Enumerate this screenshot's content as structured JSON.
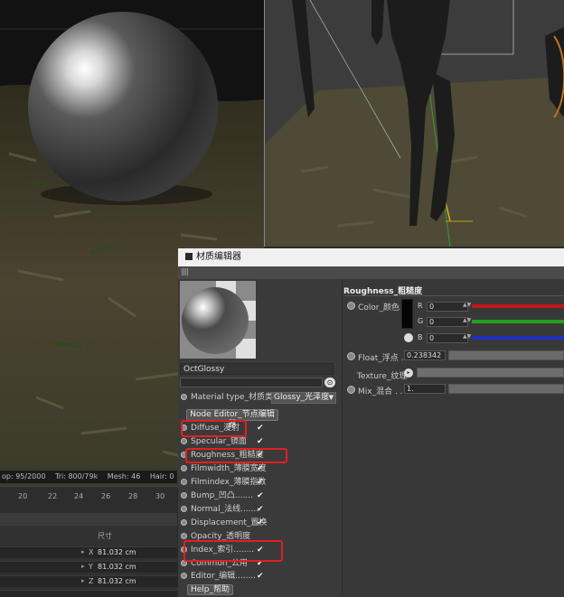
{
  "statusbar": {
    "items": [
      "op: 95/2000",
      "Tri: 800/79k",
      "Mesh: 46",
      "Hair: 0"
    ]
  },
  "timeline": {
    "ticks": [
      "20",
      "22",
      "24",
      "26",
      "28",
      "30"
    ]
  },
  "coordinates": {
    "size_label": "尺寸",
    "rows": [
      {
        "axis": "X",
        "value": "81.032 cm"
      },
      {
        "axis": "Y",
        "value": "81.032 cm"
      },
      {
        "axis": "Z",
        "value": "81.032 cm"
      }
    ]
  },
  "material_editor": {
    "title": "材质编辑器",
    "material_name": "OctGlossy",
    "material_type_label": "Material type_材质类型",
    "material_type_value": "Glossy_光泽度",
    "node_editor_label": "Node Editor_节点编辑器",
    "help_label": "Help_帮助",
    "channels": [
      {
        "label": "Diffuse_漫射",
        "dots": "",
        "checked": "✔"
      },
      {
        "label": "Specular_镜面",
        "dots": "",
        "checked": "✔"
      },
      {
        "label": "Roughness_粗糙度",
        "dots": "",
        "checked": "✔"
      },
      {
        "label": "Filmwidth_薄膜宽度",
        "dots": "",
        "checked": "✔"
      },
      {
        "label": "Filmindex_薄膜指数",
        "dots": "",
        "checked": "✔"
      },
      {
        "label": "Bump_凹凸",
        "dots": ".......",
        "checked": "✔"
      },
      {
        "label": "Normal_法线",
        "dots": ".......",
        "checked": "✔"
      },
      {
        "label": "Displacement_置换",
        "dots": "",
        "checked": "✔"
      },
      {
        "label": "Opacity_透明度",
        "dots": "",
        "checked": ""
      },
      {
        "label": "Index_索引",
        "dots": "........",
        "checked": "✔"
      },
      {
        "label": "Common_公用",
        "dots": "",
        "checked": "✔"
      },
      {
        "label": "Editor_编辑",
        "dots": "........",
        "checked": "✔"
      }
    ],
    "roughness_panel": {
      "header": "Roughness_粗糙度",
      "color_label": "Color_颜色",
      "r_label": "R",
      "r_value": "0",
      "g_label": "G",
      "g_value": "0",
      "b_label": "B",
      "b_value": "0",
      "float_label": "Float_浮点 . .",
      "float_value": "0.238342",
      "texture_label": "Texture_纹理",
      "mix_label": "Mix_混合 . . .",
      "mix_value": "1."
    }
  },
  "colors": {
    "highlight": "#e02020",
    "red_bar": "#c01818",
    "green_bar": "#20a020",
    "blue_bar": "#2030c0"
  }
}
